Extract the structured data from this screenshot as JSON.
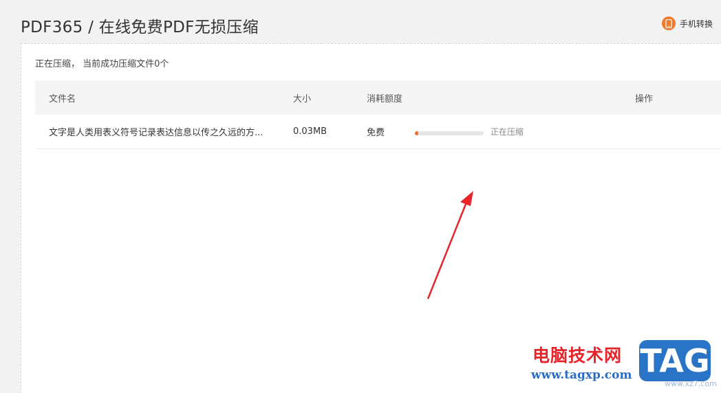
{
  "header": {
    "title": "PDF365 / 在线免费PDF无损压缩",
    "mobile_convert_label": "手机转换",
    "mobile_icon": "mobile-phone-icon"
  },
  "status": {
    "text": "正在压缩， 当前成功压缩文件0个"
  },
  "table": {
    "columns": [
      "文件名",
      "大小",
      "消耗额度",
      "操作"
    ],
    "rows": [
      {
        "file_name": "文字是人类用表义符号记录表达信息以传之久远的方...",
        "size": "0.03MB",
        "quota": "免费",
        "progress": 0.05,
        "progress_label": "正在压缩",
        "action": ""
      }
    ]
  },
  "colors": {
    "accent": "#f26a2e",
    "annotation_arrow": "#e8232a"
  },
  "watermark": {
    "site_name_cn": "电脑技术网",
    "url": "www.tagxp.com",
    "badge": "TAG",
    "small_text": "www.xz7.com"
  }
}
